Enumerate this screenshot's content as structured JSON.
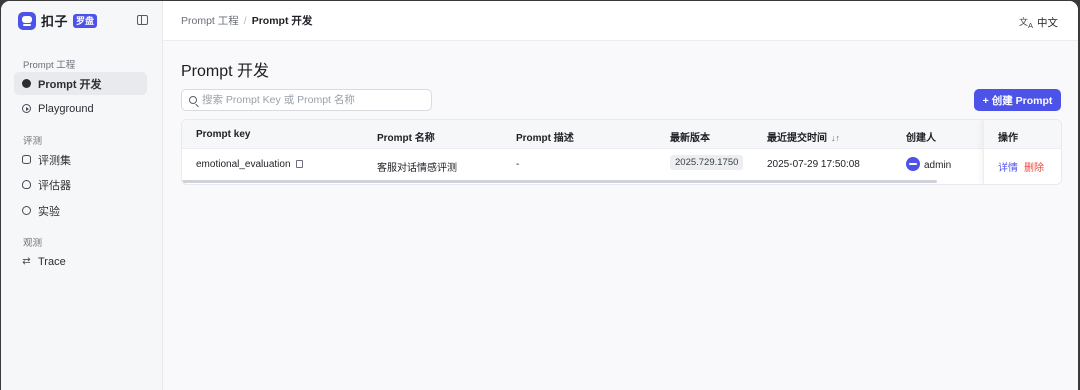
{
  "app": {
    "logo_text": "扣子",
    "logo_badge": "罗盘"
  },
  "sidebar": {
    "groups": [
      {
        "label": "Prompt 工程"
      },
      {
        "label": "评测"
      },
      {
        "label": "观测"
      }
    ],
    "items": [
      {
        "label": "Prompt 开发",
        "icon": "chat-icon"
      },
      {
        "label": "Playground",
        "icon": "play-icon"
      },
      {
        "label": "评测集",
        "icon": "database-icon"
      },
      {
        "label": "评估器",
        "icon": "bulb-icon"
      },
      {
        "label": "实验",
        "icon": "experiment-icon"
      },
      {
        "label": "Trace",
        "icon": "trace-icon"
      }
    ]
  },
  "topbar": {
    "breadcrumb": [
      "Prompt 工程",
      "Prompt 开发"
    ],
    "language": "中文"
  },
  "page": {
    "title": "Prompt 开发",
    "search_placeholder": "搜索 Prompt Key 或 Prompt 名称",
    "create_label": "+ 创建 Prompt"
  },
  "table": {
    "columns": [
      "Prompt key",
      "Prompt 名称",
      "Prompt 描述",
      "最新版本",
      "最近提交时间",
      "创建人",
      "操作"
    ],
    "rows": [
      {
        "key": "emotional_evaluation",
        "name": "客服对话情感评测",
        "description": "-",
        "version": "2025.729.1750",
        "submitted": "2025-07-29 17:50:08",
        "creator": "admin",
        "actions": [
          "详情",
          "删除"
        ]
      }
    ]
  },
  "colors": {
    "accent": "#4d53e8",
    "danger": "#f0443b"
  }
}
